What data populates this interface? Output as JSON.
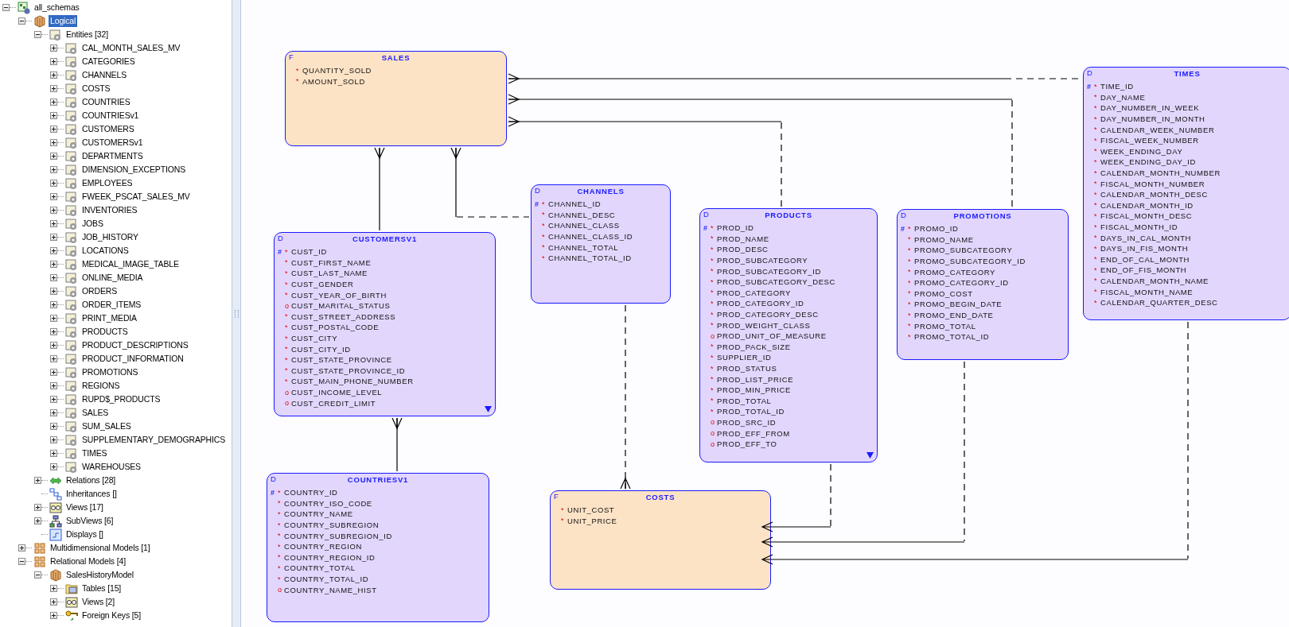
{
  "tree": [
    {
      "label": "all_schemas",
      "kind": "schema",
      "selected": false,
      "expanded": true,
      "children": [
        {
          "label": "Logical",
          "kind": "model",
          "selected": true,
          "expanded": true,
          "children": [
            {
              "label": "Entities [32]",
              "kind": "entity",
              "selected": false,
              "expanded": true,
              "children": [
                {
                  "label": "CAL_MONTH_SALES_MV",
                  "kind": "entity",
                  "selected": false,
                  "expanded": false
                },
                {
                  "label": "CATEGORIES",
                  "kind": "entity",
                  "selected": false,
                  "expanded": false
                },
                {
                  "label": "CHANNELS",
                  "kind": "entity",
                  "selected": false,
                  "expanded": false
                },
                {
                  "label": "COSTS",
                  "kind": "entity",
                  "selected": false,
                  "expanded": false
                },
                {
                  "label": "COUNTRIES",
                  "kind": "entity",
                  "selected": false,
                  "expanded": false
                },
                {
                  "label": "COUNTRIESv1",
                  "kind": "entity",
                  "selected": false,
                  "expanded": false
                },
                {
                  "label": "CUSTOMERS",
                  "kind": "entity",
                  "selected": false,
                  "expanded": false
                },
                {
                  "label": "CUSTOMERSv1",
                  "kind": "entity",
                  "selected": false,
                  "expanded": false
                },
                {
                  "label": "DEPARTMENTS",
                  "kind": "entity",
                  "selected": false,
                  "expanded": false
                },
                {
                  "label": "DIMENSION_EXCEPTIONS",
                  "kind": "entity",
                  "selected": false,
                  "expanded": false
                },
                {
                  "label": "EMPLOYEES",
                  "kind": "entity",
                  "selected": false,
                  "expanded": false
                },
                {
                  "label": "FWEEK_PSCAT_SALES_MV",
                  "kind": "entity",
                  "selected": false,
                  "expanded": false
                },
                {
                  "label": "INVENTORIES",
                  "kind": "entity",
                  "selected": false,
                  "expanded": false
                },
                {
                  "label": "JOBS",
                  "kind": "entity",
                  "selected": false,
                  "expanded": false
                },
                {
                  "label": "JOB_HISTORY",
                  "kind": "entity",
                  "selected": false,
                  "expanded": false
                },
                {
                  "label": "LOCATIONS",
                  "kind": "entity",
                  "selected": false,
                  "expanded": false
                },
                {
                  "label": "MEDICAL_IMAGE_TABLE",
                  "kind": "entity",
                  "selected": false,
                  "expanded": false
                },
                {
                  "label": "ONLINE_MEDIA",
                  "kind": "entity",
                  "selected": false,
                  "expanded": false
                },
                {
                  "label": "ORDERS",
                  "kind": "entity",
                  "selected": false,
                  "expanded": false
                },
                {
                  "label": "ORDER_ITEMS",
                  "kind": "entity",
                  "selected": false,
                  "expanded": false
                },
                {
                  "label": "PRINT_MEDIA",
                  "kind": "entity",
                  "selected": false,
                  "expanded": false
                },
                {
                  "label": "PRODUCTS",
                  "kind": "entity",
                  "selected": false,
                  "expanded": false
                },
                {
                  "label": "PRODUCT_DESCRIPTIONS",
                  "kind": "entity",
                  "selected": false,
                  "expanded": false
                },
                {
                  "label": "PRODUCT_INFORMATION",
                  "kind": "entity",
                  "selected": false,
                  "expanded": false
                },
                {
                  "label": "PROMOTIONS",
                  "kind": "entity",
                  "selected": false,
                  "expanded": false
                },
                {
                  "label": "REGIONS",
                  "kind": "entity",
                  "selected": false,
                  "expanded": false
                },
                {
                  "label": "RUPD$_PRODUCTS",
                  "kind": "entity",
                  "selected": false,
                  "expanded": false
                },
                {
                  "label": "SALES",
                  "kind": "entity",
                  "selected": false,
                  "expanded": false
                },
                {
                  "label": "SUM_SALES",
                  "kind": "entity",
                  "selected": false,
                  "expanded": false
                },
                {
                  "label": "SUPPLEMENTARY_DEMOGRAPHICS",
                  "kind": "entity",
                  "selected": false,
                  "expanded": false
                },
                {
                  "label": "TIMES",
                  "kind": "entity",
                  "selected": false,
                  "expanded": false
                },
                {
                  "label": "WAREHOUSES",
                  "kind": "entity",
                  "selected": false,
                  "expanded": false
                }
              ]
            },
            {
              "label": "Relations [28]",
              "kind": "relations",
              "selected": false,
              "expanded": false
            },
            {
              "label": "Inheritances []",
              "kind": "inheritances",
              "selected": false
            },
            {
              "label": "Views [17]",
              "kind": "views",
              "selected": false,
              "expanded": false
            },
            {
              "label": "SubViews [6]",
              "kind": "subviews",
              "selected": false,
              "expanded": false
            },
            {
              "label": "Displays []",
              "kind": "displays",
              "selected": false
            }
          ]
        },
        {
          "label": "Multidimensional Models [1]",
          "kind": "models",
          "selected": false,
          "expanded": false
        },
        {
          "label": "Relational Models [4]",
          "kind": "models",
          "selected": false,
          "expanded": true,
          "children": [
            {
              "label": "SalesHistoryModel",
              "kind": "model",
              "selected": false,
              "expanded": true,
              "children": [
                {
                  "label": "Tables [15]",
                  "kind": "tables",
                  "selected": false,
                  "expanded": false
                },
                {
                  "label": "Views [2]",
                  "kind": "tableviews",
                  "selected": false,
                  "expanded": false
                },
                {
                  "label": "Foreign Keys [5]",
                  "kind": "foreignkeys",
                  "selected": false,
                  "expanded": false
                }
              ]
            }
          ]
        }
      ]
    }
  ],
  "entities": [
    {
      "type": "F",
      "kind": "fact",
      "name": "SALES",
      "attributes": [
        {
          "flag": "*",
          "name": "QUANTITY_SOLD"
        },
        {
          "flag": "*",
          "name": "AMOUNT_SOLD"
        }
      ]
    },
    {
      "type": "D",
      "kind": "dimension",
      "name": "CUSTOMERSV1",
      "more": true,
      "attributes": [
        {
          "key": "#",
          "flag": "*",
          "name": "CUST_ID"
        },
        {
          "flag": "*",
          "name": "CUST_FIRST_NAME"
        },
        {
          "flag": "*",
          "name": "CUST_LAST_NAME"
        },
        {
          "flag": "*",
          "name": "CUST_GENDER"
        },
        {
          "flag": "*",
          "name": "CUST_YEAR_OF_BIRTH"
        },
        {
          "flag": "o",
          "name": "CUST_MARITAL_STATUS"
        },
        {
          "flag": "*",
          "name": "CUST_STREET_ADDRESS"
        },
        {
          "flag": "*",
          "name": "CUST_POSTAL_CODE"
        },
        {
          "flag": "*",
          "name": "CUST_CITY"
        },
        {
          "flag": "*",
          "name": "CUST_CITY_ID"
        },
        {
          "flag": "*",
          "name": "CUST_STATE_PROVINCE"
        },
        {
          "flag": "*",
          "name": "CUST_STATE_PROVINCE_ID"
        },
        {
          "flag": "*",
          "name": "CUST_MAIN_PHONE_NUMBER"
        },
        {
          "flag": "o",
          "name": "CUST_INCOME_LEVEL"
        },
        {
          "flag": "o",
          "name": "CUST_CREDIT_LIMIT"
        }
      ]
    },
    {
      "type": "D",
      "kind": "dimension",
      "name": "CHANNELS",
      "attributes": [
        {
          "key": "#",
          "flag": "*",
          "name": "CHANNEL_ID"
        },
        {
          "flag": "*",
          "name": "CHANNEL_DESC"
        },
        {
          "flag": "*",
          "name": "CHANNEL_CLASS"
        },
        {
          "flag": "*",
          "name": "CHANNEL_CLASS_ID"
        },
        {
          "flag": "*",
          "name": "CHANNEL_TOTAL"
        },
        {
          "flag": "*",
          "name": "CHANNEL_TOTAL_ID"
        }
      ]
    },
    {
      "type": "D",
      "kind": "dimension",
      "name": "PRODUCTS",
      "more": true,
      "attributes": [
        {
          "key": "#",
          "flag": "*",
          "name": "PROD_ID"
        },
        {
          "flag": "*",
          "name": "PROD_NAME"
        },
        {
          "flag": "*",
          "name": "PROD_DESC"
        },
        {
          "flag": "*",
          "name": "PROD_SUBCATEGORY"
        },
        {
          "flag": "*",
          "name": "PROD_SUBCATEGORY_ID"
        },
        {
          "flag": "*",
          "name": "PROD_SUBCATEGORY_DESC"
        },
        {
          "flag": "*",
          "name": "PROD_CATEGORY"
        },
        {
          "flag": "*",
          "name": "PROD_CATEGORY_ID"
        },
        {
          "flag": "*",
          "name": "PROD_CATEGORY_DESC"
        },
        {
          "flag": "*",
          "name": "PROD_WEIGHT_CLASS"
        },
        {
          "flag": "o",
          "name": "PROD_UNIT_OF_MEASURE"
        },
        {
          "flag": "*",
          "name": "PROD_PACK_SIZE"
        },
        {
          "flag": "*",
          "name": "SUPPLIER_ID"
        },
        {
          "flag": "*",
          "name": "PROD_STATUS"
        },
        {
          "flag": "*",
          "name": "PROD_LIST_PRICE"
        },
        {
          "flag": "*",
          "name": "PROD_MIN_PRICE"
        },
        {
          "flag": "*",
          "name": "PROD_TOTAL"
        },
        {
          "flag": "*",
          "name": "PROD_TOTAL_ID"
        },
        {
          "flag": "o",
          "name": "PROD_SRC_ID"
        },
        {
          "flag": "o",
          "name": "PROD_EFF_FROM"
        },
        {
          "flag": "o",
          "name": "PROD_EFF_TO"
        }
      ]
    },
    {
      "type": "D",
      "kind": "dimension",
      "name": "PROMOTIONS",
      "attributes": [
        {
          "key": "#",
          "flag": "*",
          "name": "PROMO_ID"
        },
        {
          "flag": "*",
          "name": "PROMO_NAME"
        },
        {
          "flag": "*",
          "name": "PROMO_SUBCATEGORY"
        },
        {
          "flag": "*",
          "name": "PROMO_SUBCATEGORY_ID"
        },
        {
          "flag": "*",
          "name": "PROMO_CATEGORY"
        },
        {
          "flag": "*",
          "name": "PROMO_CATEGORY_ID"
        },
        {
          "flag": "*",
          "name": "PROMO_COST"
        },
        {
          "flag": "*",
          "name": "PROMO_BEGIN_DATE"
        },
        {
          "flag": "*",
          "name": "PROMO_END_DATE"
        },
        {
          "flag": "*",
          "name": "PROMO_TOTAL"
        },
        {
          "flag": "*",
          "name": "PROMO_TOTAL_ID"
        }
      ]
    },
    {
      "type": "D",
      "kind": "dimension",
      "name": "TIMES",
      "attributes": [
        {
          "key": "#",
          "flag": "*",
          "name": "TIME_ID"
        },
        {
          "flag": "*",
          "name": "DAY_NAME"
        },
        {
          "flag": "*",
          "name": "DAY_NUMBER_IN_WEEK"
        },
        {
          "flag": "*",
          "name": "DAY_NUMBER_IN_MONTH"
        },
        {
          "flag": "*",
          "name": "CALENDAR_WEEK_NUMBER"
        },
        {
          "flag": "*",
          "name": "FISCAL_WEEK_NUMBER"
        },
        {
          "flag": "*",
          "name": "WEEK_ENDING_DAY"
        },
        {
          "flag": "*",
          "name": "WEEK_ENDING_DAY_ID"
        },
        {
          "flag": "*",
          "name": "CALENDAR_MONTH_NUMBER"
        },
        {
          "flag": "*",
          "name": "FISCAL_MONTH_NUMBER"
        },
        {
          "flag": "*",
          "name": "CALENDAR_MONTH_DESC"
        },
        {
          "flag": "*",
          "name": "CALENDAR_MONTH_ID"
        },
        {
          "flag": "*",
          "name": "FISCAL_MONTH_DESC"
        },
        {
          "flag": "*",
          "name": "FISCAL_MONTH_ID"
        },
        {
          "flag": "*",
          "name": "DAYS_IN_CAL_MONTH"
        },
        {
          "flag": "*",
          "name": "DAYS_IN_FIS_MONTH"
        },
        {
          "flag": "*",
          "name": "END_OF_CAL_MONTH"
        },
        {
          "flag": "*",
          "name": "END_OF_FIS_MONTH"
        },
        {
          "flag": "*",
          "name": "CALENDAR_MONTH_NAME"
        },
        {
          "flag": "*",
          "name": "FISCAL_MONTH_NAME"
        },
        {
          "flag": "*",
          "name": "CALENDAR_QUARTER_DESC"
        }
      ]
    },
    {
      "type": "D",
      "kind": "dimension",
      "name": "COUNTRIESV1",
      "attributes": [
        {
          "key": "#",
          "flag": "*",
          "name": "COUNTRY_ID"
        },
        {
          "flag": "*",
          "name": "COUNTRY_ISO_CODE"
        },
        {
          "flag": "*",
          "name": "COUNTRY_NAME"
        },
        {
          "flag": "*",
          "name": "COUNTRY_SUBREGION"
        },
        {
          "flag": "*",
          "name": "COUNTRY_SUBREGION_ID"
        },
        {
          "flag": "*",
          "name": "COUNTRY_REGION"
        },
        {
          "flag": "*",
          "name": "COUNTRY_REGION_ID"
        },
        {
          "flag": "*",
          "name": "COUNTRY_TOTAL"
        },
        {
          "flag": "*",
          "name": "COUNTRY_TOTAL_ID"
        },
        {
          "flag": "o",
          "name": "COUNTRY_NAME_HIST"
        }
      ]
    },
    {
      "type": "F",
      "kind": "fact",
      "name": "COSTS",
      "attributes": [
        {
          "flag": "*",
          "name": "UNIT_COST"
        },
        {
          "flag": "*",
          "name": "UNIT_PRICE"
        }
      ]
    }
  ]
}
